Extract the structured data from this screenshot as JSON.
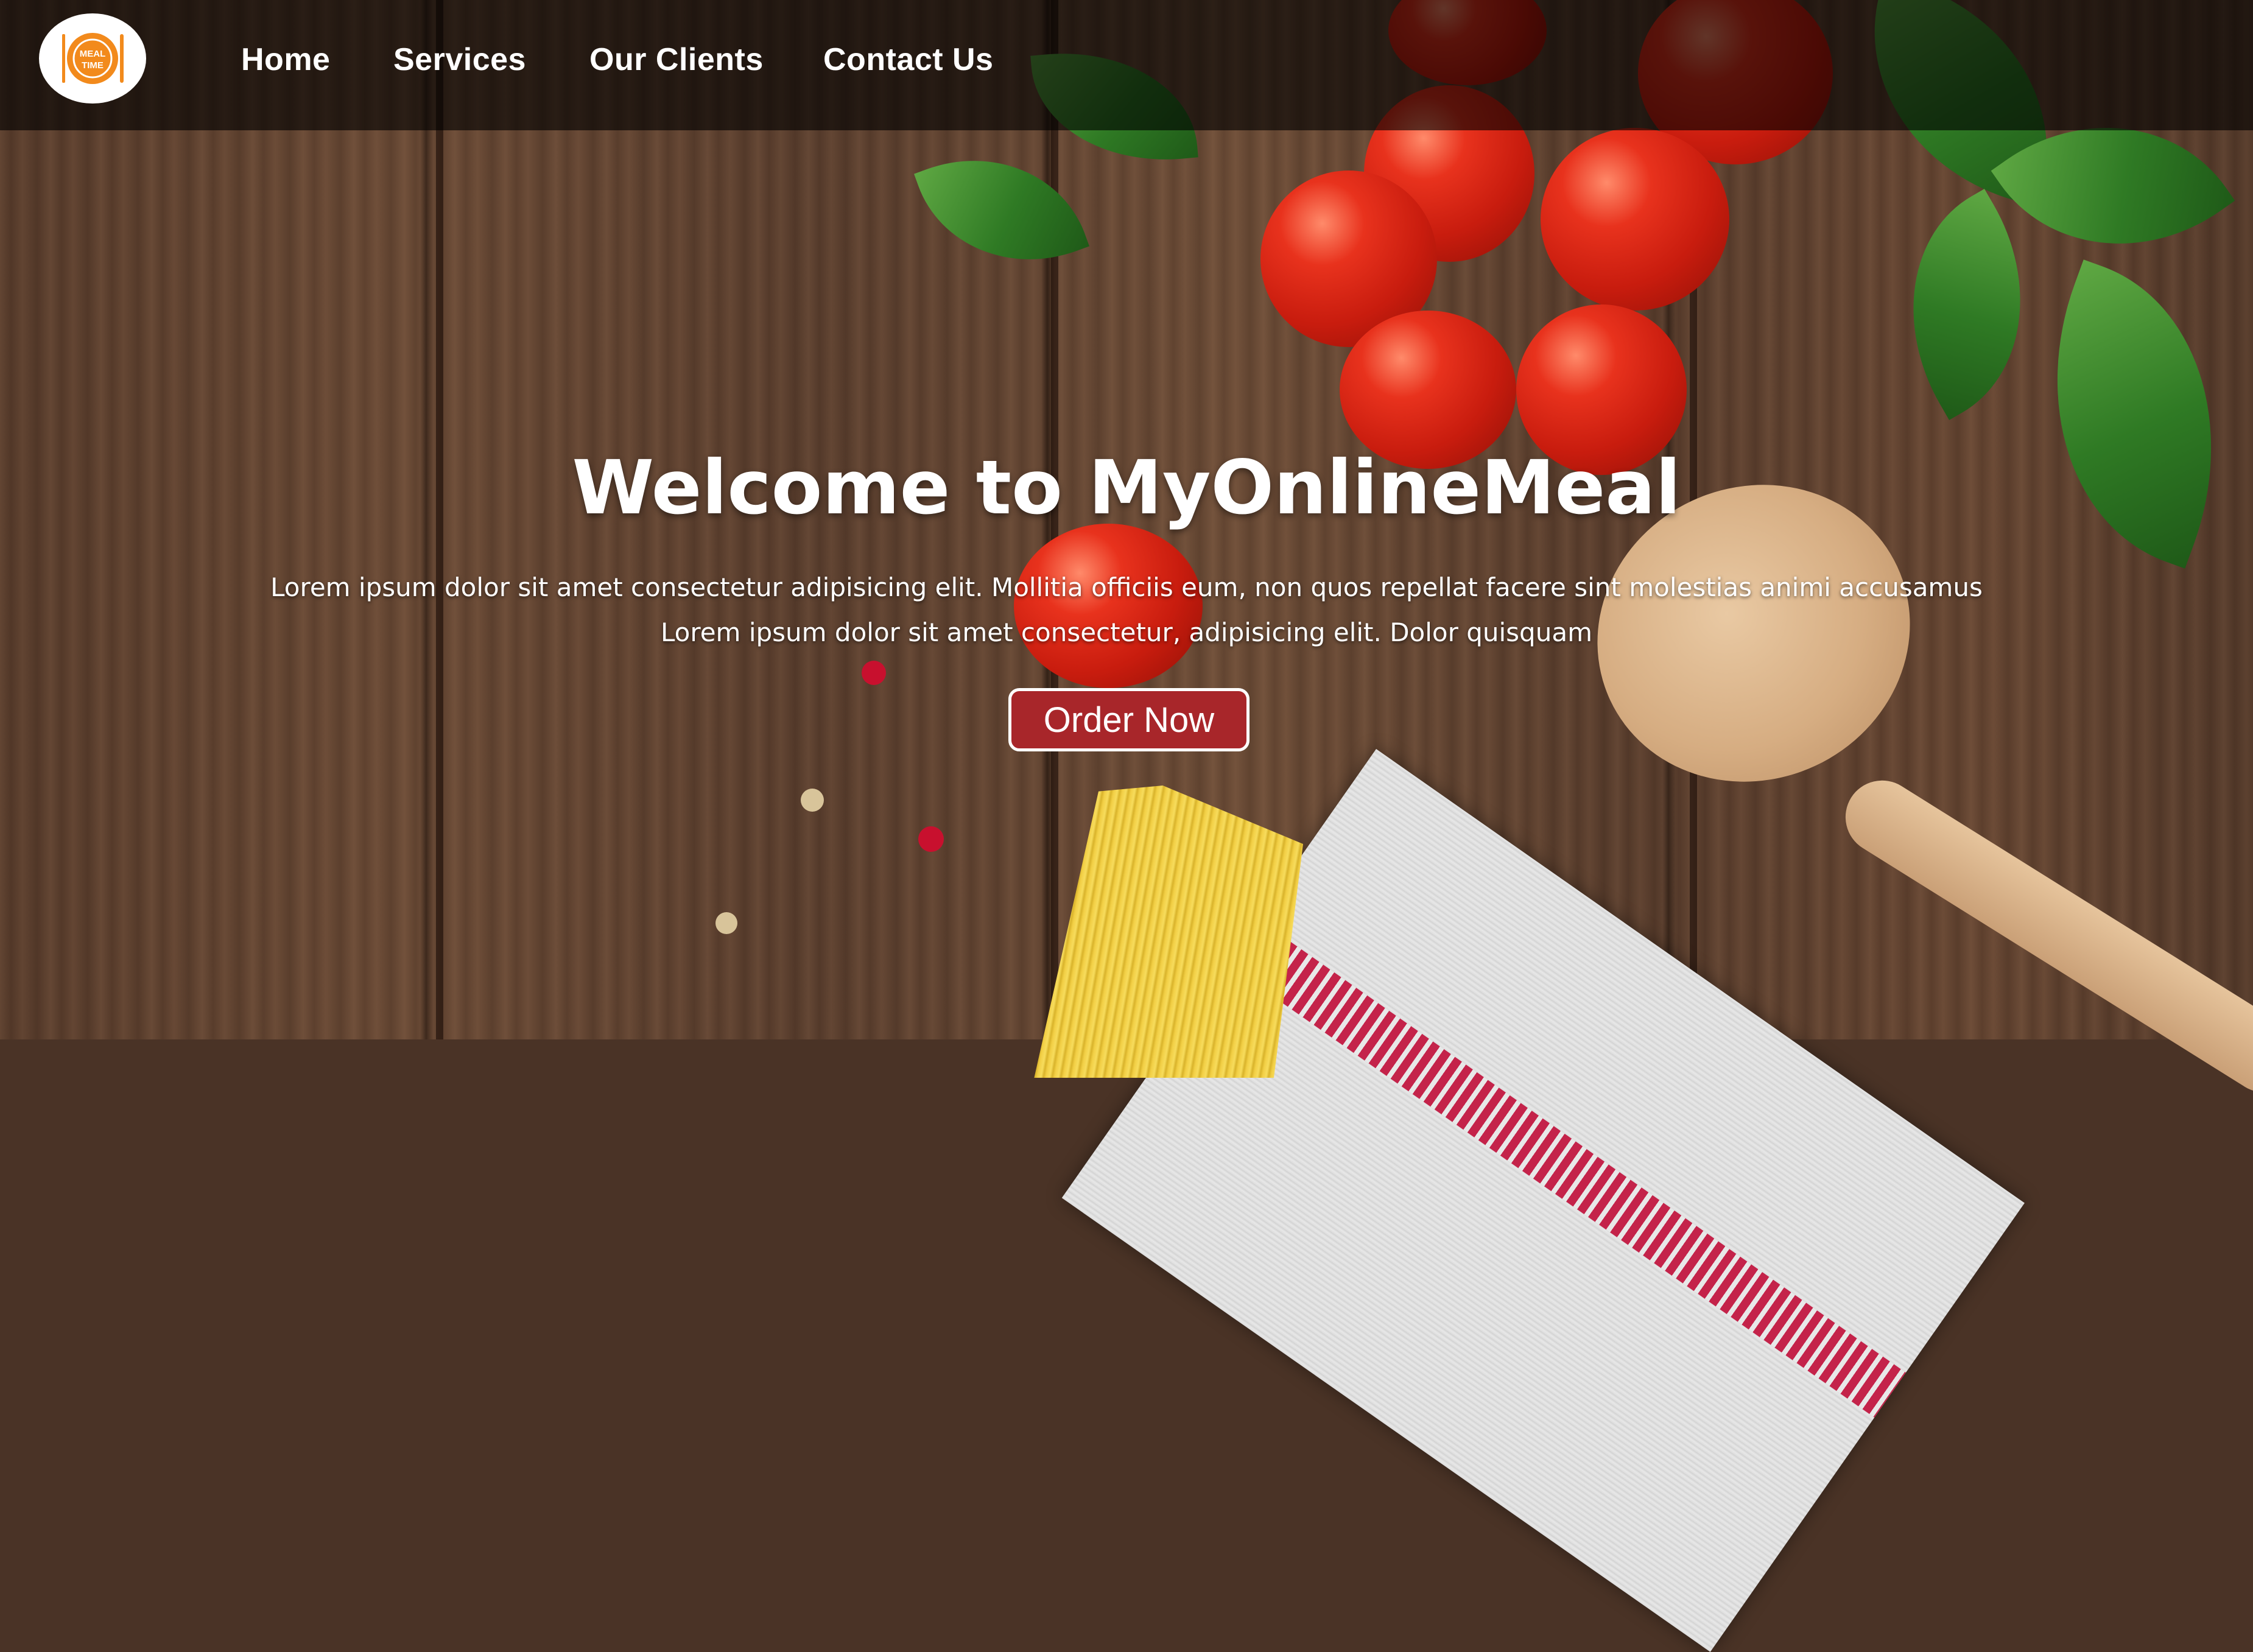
{
  "logo": {
    "line1": "MEAL",
    "line2": "TIME",
    "icon": "plate-fork-knife-icon",
    "color": "#f28a1c"
  },
  "nav": {
    "items": [
      {
        "label": "Home"
      },
      {
        "label": "Services"
      },
      {
        "label": "Our Clients"
      },
      {
        "label": "Contact Us"
      }
    ]
  },
  "hero": {
    "title": "Welcome to MyOnlineMeal",
    "line1": "Lorem ipsum dolor sit amet consectetur adipisicing elit. Mollitia officiis eum, non quos repellat facere sint molestias animi accusamus",
    "line2": "Lorem ipsum dolor sit amet consectetur, adipisicing elit. Dolor quisquam",
    "button_label": "Order Now",
    "button_color": "#a8262a"
  }
}
